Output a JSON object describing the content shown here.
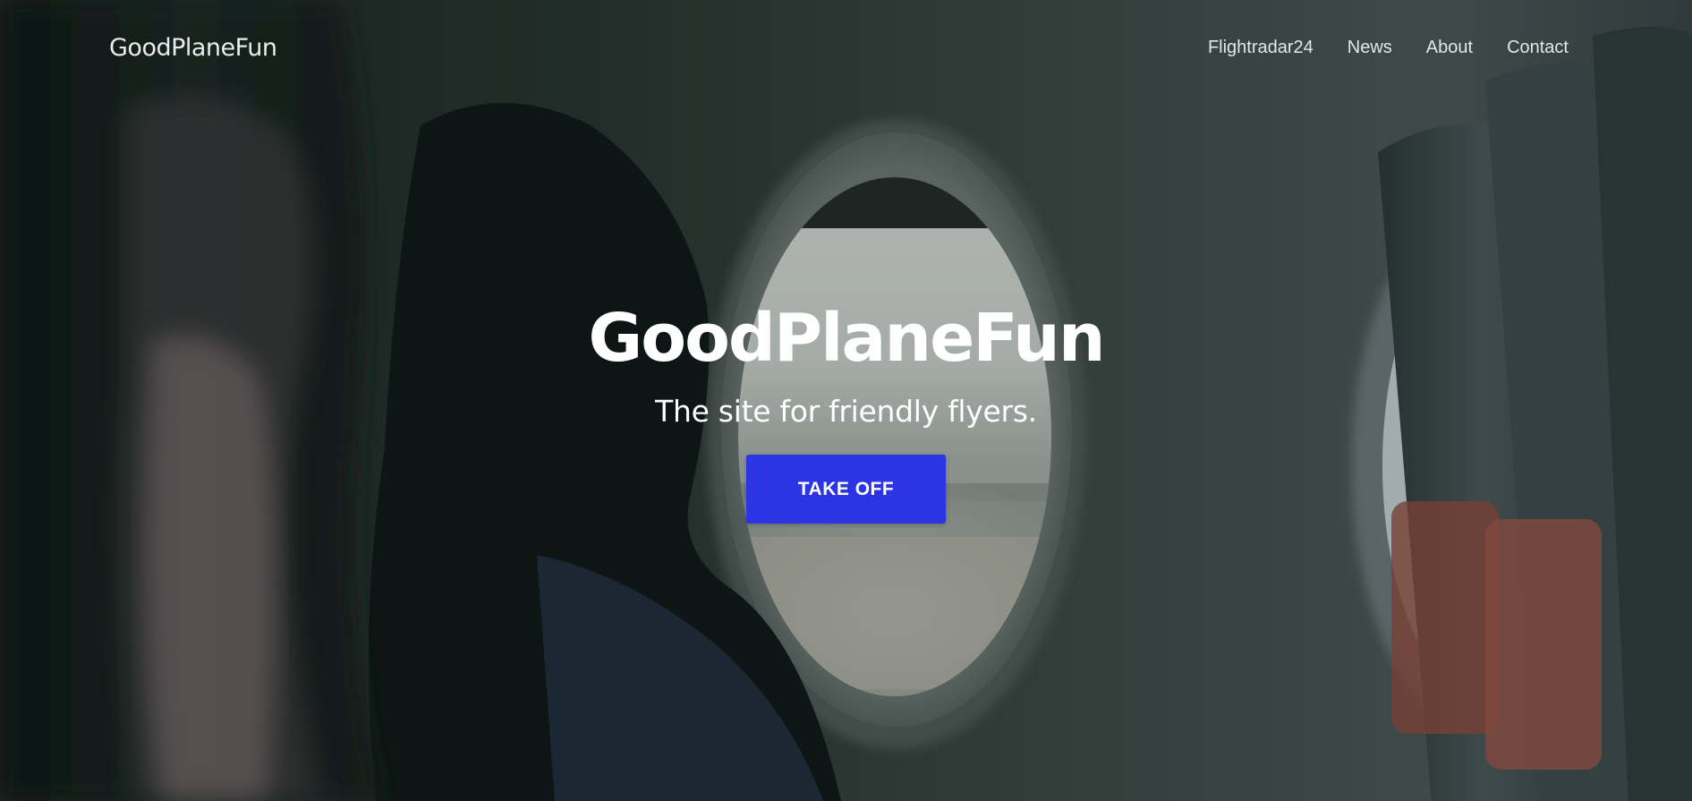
{
  "brand": "GoodPlaneFun",
  "nav": {
    "links": [
      "Flightradar24",
      "News",
      "About",
      "Contact"
    ]
  },
  "hero": {
    "title": "GoodPlaneFun",
    "subtitle": "The site for friendly flyers.",
    "cta_label": "TAKE OFF",
    "background_description_icon": "airplane-cabin-window-photo"
  },
  "colors": {
    "cta_background": "#2b35e6",
    "text": "#ffffff",
    "nav_text": "#e3e7e6"
  }
}
